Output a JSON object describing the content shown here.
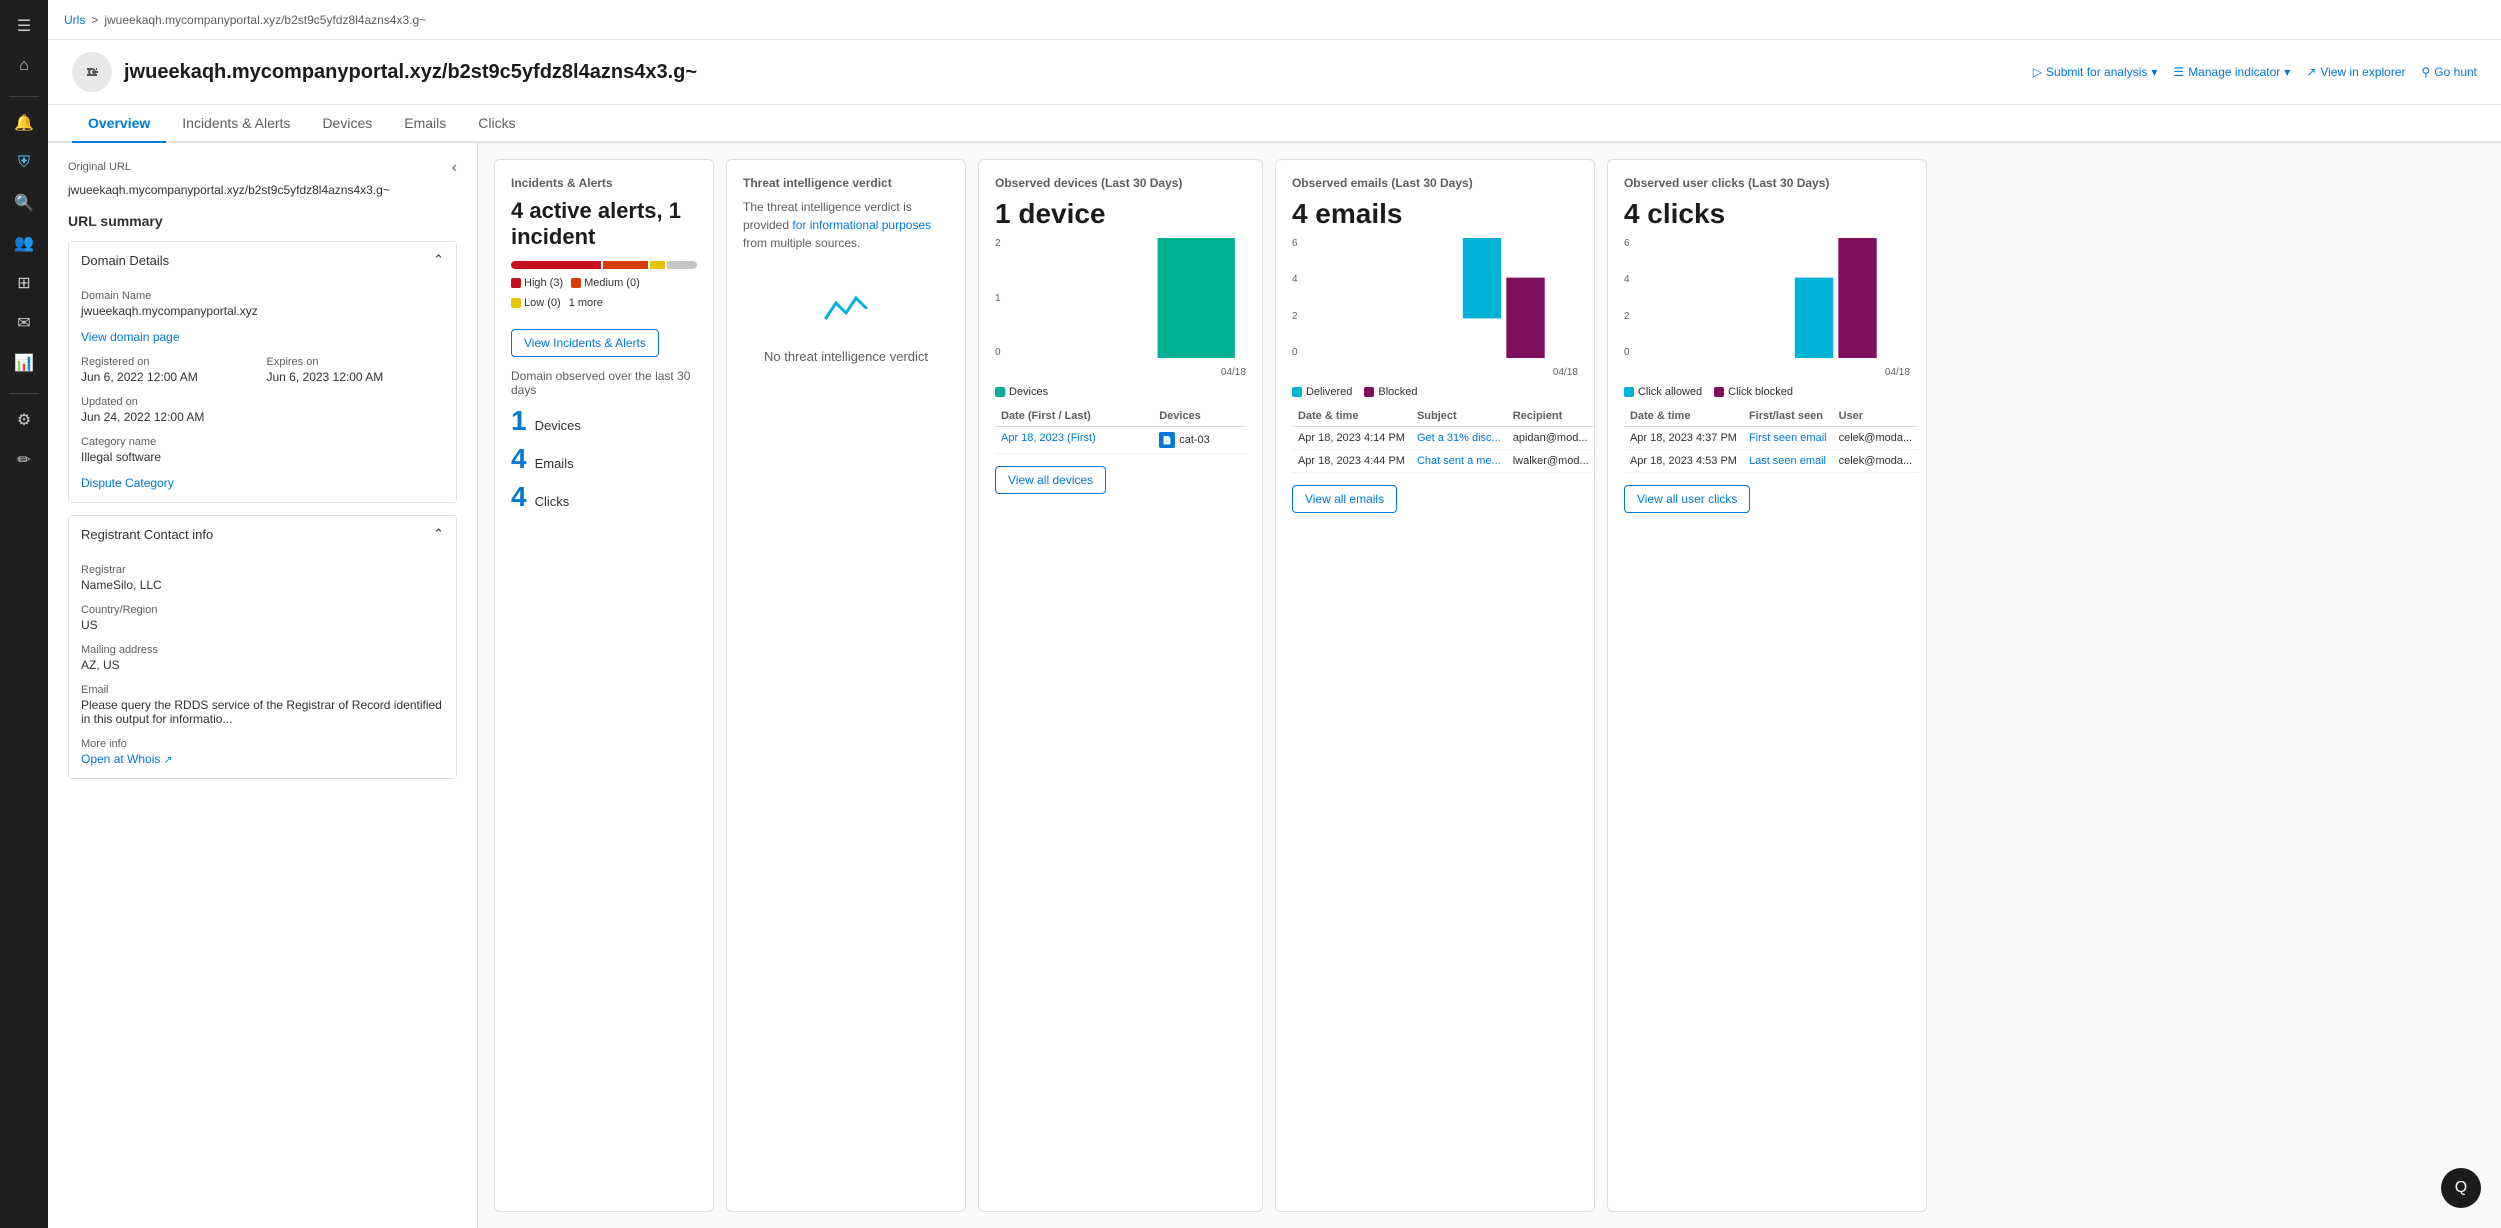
{
  "breadcrumb": {
    "parent": "Urls",
    "separator": ">",
    "current": "jwueekaqh.mycompanyportal.xyz/b2st9c5yfdz8l4azns4x3.g~"
  },
  "page_title": "jwueekaqh.mycompanyportal.xyz/b2st9c5yfdz8l4azns4x3.g~",
  "header_actions": {
    "submit": "Submit for analysis",
    "manage": "Manage indicator",
    "explorer": "View in explorer",
    "hunt": "Go hunt"
  },
  "tabs": [
    "Overview",
    "Incidents & Alerts",
    "Devices",
    "Emails",
    "Clicks"
  ],
  "active_tab": "Overview",
  "left_panel": {
    "original_url_label": "Original URL",
    "original_url_value": "jwueekaqh.mycompanyportal.xyz/b2st9c5yfdz8l4azns4x3.g~",
    "url_summary_title": "URL summary",
    "domain_details_title": "Domain Details",
    "domain_name_label": "Domain Name",
    "domain_name_value": "jwueekaqh.mycompanyportal.xyz",
    "domain_page_link": "View domain page",
    "registered_on_label": "Registered on",
    "registered_on_value": "Jun 6, 2022 12:00 AM",
    "updated_on_label": "Updated on",
    "updated_on_value": "Jun 24, 2022 12:00 AM",
    "expires_on_label": "Expires on",
    "expires_on_value": "Jun 6, 2023 12:00 AM",
    "category_name_label": "Category name",
    "category_name_value": "Illegal software",
    "dispute_category_link": "Dispute Category",
    "registrant_contact_title": "Registrant Contact info",
    "registrar_label": "Registrar",
    "registrar_value": "NameSilo, LLC",
    "country_label": "Country/Region",
    "country_value": "US",
    "mailing_label": "Mailing address",
    "mailing_value": "AZ, US",
    "email_label": "Email",
    "email_value": "Please query the RDDS service of the Registrar of Record identified in this output for informatio...",
    "more_info_label": "More info",
    "whois_link": "Open at Whois"
  },
  "incidents_alerts": {
    "card_title": "Incidents & Alerts",
    "alert_text": "4 active alerts, 1 incident",
    "severity_high": "High (3)",
    "severity_medium": "Medium (0)",
    "severity_low": "Low (0)",
    "severity_more": "1 more",
    "view_btn": "View Incidents & Alerts",
    "domain_observed_title": "Domain observed over the last 30 days",
    "devices_count": "1",
    "emails_count": "4",
    "clicks_count": "4",
    "devices_label": "Devices",
    "emails_label": "Emails",
    "clicks_label": "Clicks"
  },
  "threat_intelligence": {
    "card_title": "Threat intelligence verdict",
    "info_text": "The threat intelligence verdict is provided for informational purposes from multiple sources.",
    "no_threat_text": "No threat intelligence verdict"
  },
  "observed_devices": {
    "card_title": "Observed devices (Last 30 Days)",
    "count": "1 device",
    "chart_y_labels": [
      "2",
      "1",
      "0"
    ],
    "chart_x_label": "04/18",
    "legend_label": "Devices",
    "legend_color": "#00b294",
    "table_headers": [
      "Date (First / Last)",
      "Devices"
    ],
    "table_rows": [
      {
        "date": "Apr 18, 2023 (First)",
        "devices": ""
      }
    ],
    "view_btn": "View all devices"
  },
  "observed_emails": {
    "card_title": "Observed emails (Last 30 Days)",
    "count": "4 emails",
    "chart_y_labels": [
      "6",
      "4",
      "2",
      "0"
    ],
    "chart_x_label": "04/18",
    "legend_delivered": "Delivered",
    "legend_blocked": "Blocked",
    "color_delivered": "#00b2d8",
    "color_blocked": "#7c0f5e",
    "table_headers": [
      "Date & time",
      "Subject",
      "Recipient"
    ],
    "table_rows": [
      {
        "date": "Apr 18, 2023 4:14 PM",
        "subject": "Get a 31% disc...",
        "recipient": "apidan@mod..."
      },
      {
        "date": "Apr 18, 2023 4:44 PM",
        "subject": "Chat sent a me...",
        "recipient": "lwalker@mod..."
      }
    ],
    "view_btn": "View all emails"
  },
  "observed_clicks": {
    "card_title": "Observed user clicks (Last 30 Days)",
    "count": "4 clicks",
    "chart_y_labels": [
      "6",
      "4",
      "2",
      "0"
    ],
    "chart_x_label": "04/18",
    "legend_allowed": "Click allowed",
    "legend_blocked": "Click blocked",
    "color_allowed": "#00b2d8",
    "color_blocked": "#7c0f5e",
    "table_headers": [
      "Date & time",
      "First/last seen",
      "User"
    ],
    "table_rows": [
      {
        "date": "Apr 18, 2023 4:37 PM",
        "seen": "First seen email",
        "user": "celek@moda..."
      },
      {
        "date": "Apr 18, 2023 4:53 PM",
        "seen": "Last seen email",
        "user": "celek@moda..."
      }
    ],
    "view_btn": "View all user clicks"
  },
  "sidebar": {
    "icons": [
      "☰",
      "⌂",
      "🔔",
      "⛨",
      "🔍",
      "👥",
      "⚙",
      "📧",
      "📋",
      "📊",
      "✏"
    ]
  },
  "chat_btn": "Q"
}
